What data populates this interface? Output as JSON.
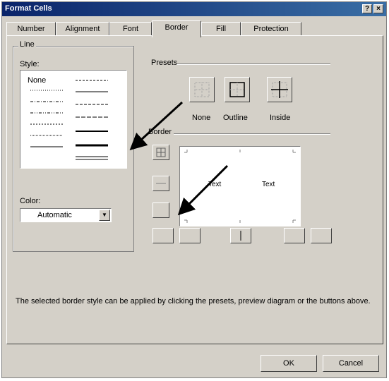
{
  "window": {
    "title": "Format Cells",
    "help_btn": "?",
    "close_btn": "×"
  },
  "tabs": [
    "Number",
    "Alignment",
    "Font",
    "Border",
    "Fill",
    "Protection"
  ],
  "active_tab": "Border",
  "line_group": {
    "label": "Line",
    "style_label": "Style:",
    "none_label": "None",
    "color_label": "Color:",
    "color_value": "Automatic"
  },
  "presets_group": {
    "label": "Presets",
    "items": [
      "None",
      "Outline",
      "Inside"
    ]
  },
  "border_group": {
    "label": "Border",
    "preview_text_1": "Text",
    "preview_text_2": "Text"
  },
  "description": "The selected border style can be applied by clicking the presets, preview diagram or the buttons above.",
  "footer": {
    "ok": "OK",
    "cancel": "Cancel"
  },
  "colors": {
    "title_start": "#0a246a",
    "title_end": "#3a6ea5",
    "face": "#d4d0c8"
  }
}
